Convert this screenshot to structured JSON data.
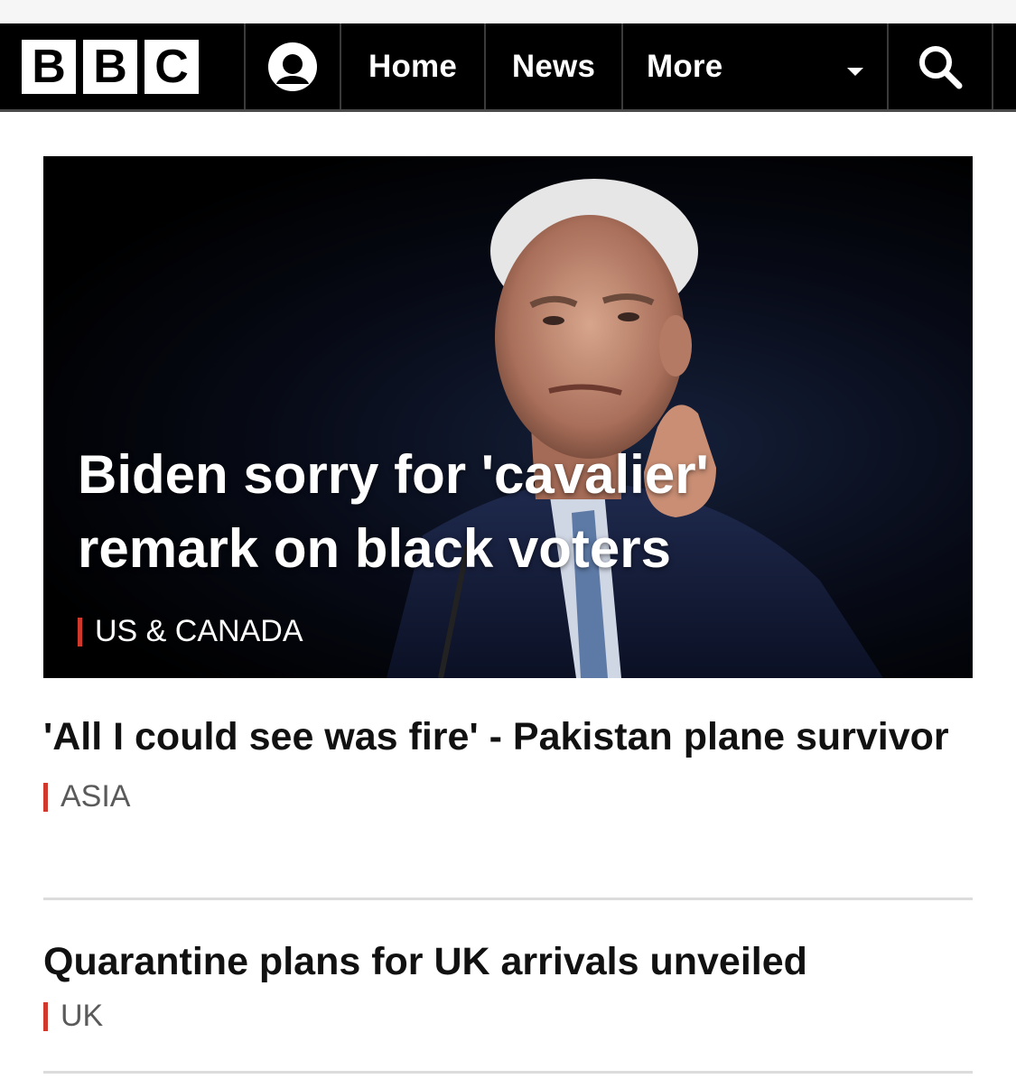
{
  "brand": {
    "logo_letters": [
      "B",
      "B",
      "C"
    ]
  },
  "nav": {
    "home_label": "Home",
    "news_label": "News",
    "more_label": "More"
  },
  "icons": {
    "account": "user-account-icon",
    "more_caret": "caret-down-icon",
    "search": "search-icon"
  },
  "colors": {
    "navbar_bg": "#000000",
    "tag_accent": "#d1382c",
    "headline_text": "#111111",
    "category_text": "#5a5a5a"
  },
  "hero": {
    "headline": "Biden sorry for 'cavalier' remark on black voters",
    "category": "US & CANADA"
  },
  "stories": [
    {
      "headline": "'All I could see was fire' - Pakistan plane survivor",
      "category": "ASIA"
    },
    {
      "headline": "Quarantine plans for UK arrivals unveiled",
      "category": "UK"
    }
  ]
}
